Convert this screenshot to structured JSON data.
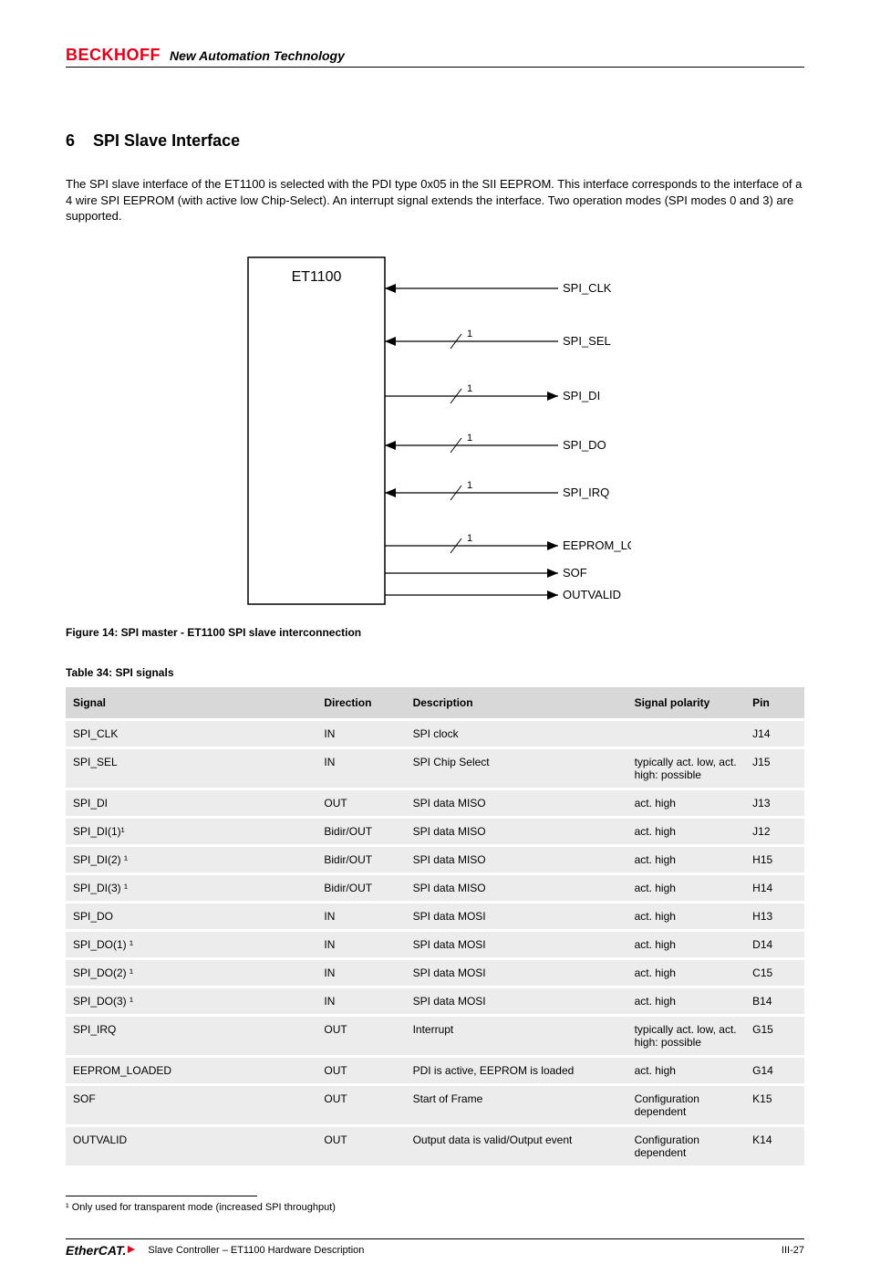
{
  "header": {
    "brand": "BECKHOFF",
    "tagline": "New Automation Technology"
  },
  "section": {
    "number": "6",
    "title": "SPI Slave Interface",
    "intro": "The SPI slave interface of the ET1100 is selected with the PDI type 0x05 in the SII EEPROM. This interface corresponds to the interface of a 4 wire SPI EEPROM (with active low Chip-Select). An interrupt signal extends the interface. Two operation modes (SPI modes 0 and 3) are supported."
  },
  "figure": {
    "caption": "Figure 14: SPI master - ET1100 SPI slave interconnection",
    "block_label": "ET1100",
    "signals": [
      {
        "name": "SPI_CLK",
        "dir": "in",
        "bus": null
      },
      {
        "name": "SPI_SEL",
        "dir": "in",
        "bus": "1"
      },
      {
        "name": "SPI_DI",
        "dir": "out",
        "bus": "1"
      },
      {
        "name": "SPI_DO",
        "dir": "in",
        "bus": "1"
      },
      {
        "name": "SPI_IRQ",
        "dir": "in",
        "bus": "1"
      },
      {
        "name": "EEPROM_LOADED",
        "dir": "out",
        "bus": "1"
      },
      {
        "name": "SOF",
        "dir": "out",
        "bus": null
      },
      {
        "name": "OUTVALID",
        "dir": "out",
        "bus": null
      }
    ]
  },
  "table": {
    "caption": "Table 34: SPI signals",
    "headers": [
      "Signal",
      "Direction",
      "Description",
      "Signal polarity",
      "Pin"
    ],
    "rows": [
      [
        "SPI_CLK",
        "IN",
        "SPI clock",
        "",
        "J14"
      ],
      [
        "SPI_SEL",
        "IN",
        "SPI Chip Select",
        "typically act. low, act. high: possible",
        "J15"
      ],
      [
        "SPI_DI",
        "OUT",
        "SPI data MISO",
        "act. high",
        "J13"
      ],
      [
        "SPI_DI(1)¹",
        "Bidir/OUT",
        "SPI data MISO",
        "act. high",
        "J12"
      ],
      [
        "SPI_DI(2) ¹",
        "Bidir/OUT",
        "SPI data MISO",
        "act. high",
        "H15"
      ],
      [
        "SPI_DI(3) ¹",
        "Bidir/OUT",
        "SPI data MISO",
        "act. high",
        "H14"
      ],
      [
        "SPI_DO",
        "IN",
        "SPI data MOSI",
        "act. high",
        "H13"
      ],
      [
        "SPI_DO(1) ¹",
        "IN",
        "SPI data MOSI",
        "act. high",
        "D14"
      ],
      [
        "SPI_DO(2) ¹",
        "IN",
        "SPI data MOSI",
        "act. high",
        "C15"
      ],
      [
        "SPI_DO(3) ¹",
        "IN",
        "SPI data MOSI",
        "act. high",
        "B14"
      ],
      [
        "SPI_IRQ",
        "OUT",
        "Interrupt",
        "typically act. low, act. high: possible",
        "G15"
      ],
      [
        "EEPROM_LOADED",
        "OUT",
        "PDI is active, EEPROM is loaded",
        "act. high",
        "G14"
      ],
      [
        "SOF",
        "OUT",
        "Start of Frame",
        "Configuration dependent",
        "K15"
      ],
      [
        "OUTVALID",
        "OUT",
        "Output data is valid/Output event",
        "Configuration dependent",
        "K14"
      ]
    ]
  },
  "footnote": "¹ Only used for transparent mode (increased SPI throughput)",
  "footer": {
    "center": "Slave Controller – ET1100 Hardware Description",
    "right": "III-27"
  }
}
